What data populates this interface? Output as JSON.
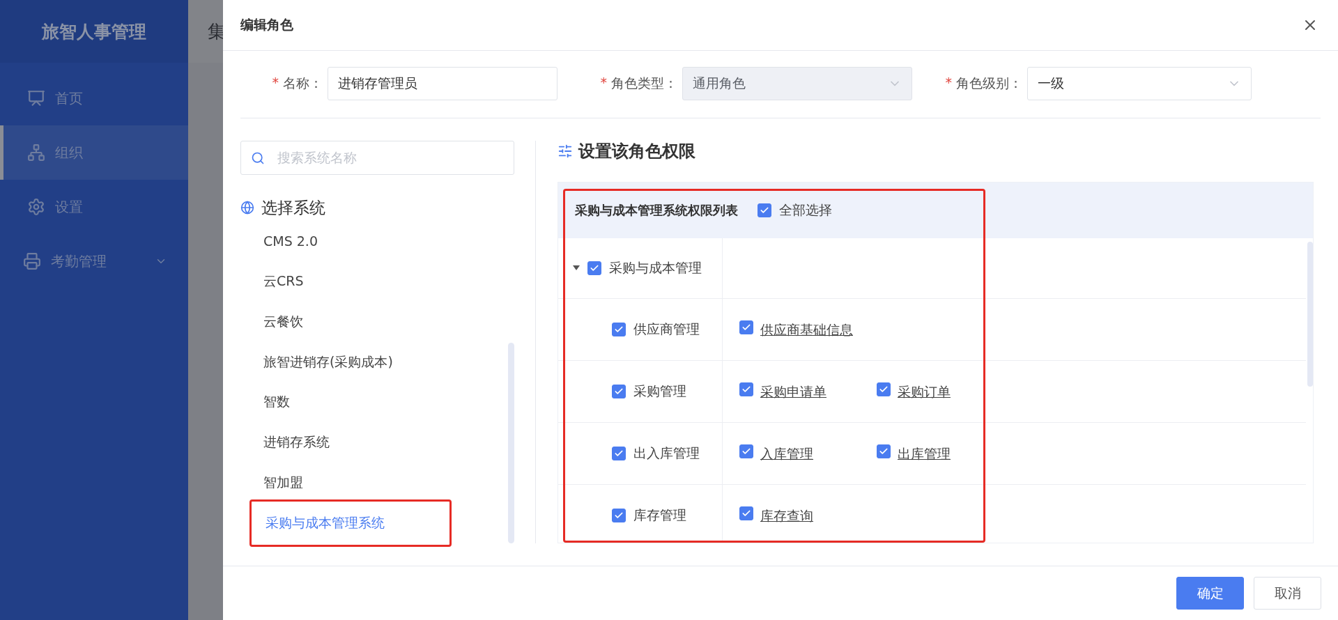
{
  "sidebar": {
    "logo": "旅智人事管理",
    "items": [
      {
        "label": "首页",
        "selected": false,
        "expandable": false
      },
      {
        "label": "组织",
        "selected": true,
        "expandable": false
      },
      {
        "label": "设置",
        "selected": false,
        "expandable": false
      },
      {
        "label": "考勤管理",
        "selected": false,
        "expandable": true
      }
    ]
  },
  "background_header": {
    "title": "集"
  },
  "dialog": {
    "title": "编辑角色",
    "fields": [
      {
        "mark": "*",
        "label": "名称：",
        "kind": "input",
        "value": "进销存管理员",
        "disabled": false
      },
      {
        "mark": "*",
        "label": "角色类型：",
        "kind": "select",
        "value": "通用角色",
        "disabled": true
      },
      {
        "mark": "*",
        "label": "角色级别：",
        "kind": "select",
        "value": "一级",
        "disabled": false
      }
    ],
    "system_panel": {
      "search": {
        "placeholder": "搜索系统名称"
      },
      "heading": "选择系统",
      "systems": [
        {
          "label": "CMS 2.0",
          "selected": false,
          "highlighted": false
        },
        {
          "label": "云CRS",
          "selected": false,
          "highlighted": false
        },
        {
          "label": "云餐饮",
          "selected": false,
          "highlighted": false
        },
        {
          "label": "旅智进销存(采购成本)",
          "selected": false,
          "highlighted": false
        },
        {
          "label": "智数",
          "selected": false,
          "highlighted": false
        },
        {
          "label": "进销存系统",
          "selected": false,
          "highlighted": false
        },
        {
          "label": "智加盟",
          "selected": false,
          "highlighted": false
        },
        {
          "label": "采购与成本管理系统",
          "selected": true,
          "highlighted": true
        }
      ]
    },
    "permissions": {
      "heading": "设置该角色权限",
      "table": {
        "title": "采购与成本管理系统权限列表",
        "highlighted": true,
        "select_all": {
          "label": "全部选择",
          "checked": true
        },
        "modules": [
          {
            "label": "采购与成本管理",
            "checked": true,
            "expanded": true,
            "groups": [
              {
                "label": "供应商管理",
                "checked": true,
                "items": [
                  {
                    "label": "供应商基础信息",
                    "checked": true
                  }
                ]
              },
              {
                "label": "采购管理",
                "checked": true,
                "items": [
                  {
                    "label": "采购申请单",
                    "checked": true
                  },
                  {
                    "label": "采购订单",
                    "checked": true
                  }
                ]
              },
              {
                "label": "出入库管理",
                "checked": true,
                "items": [
                  {
                    "label": "入库管理",
                    "checked": true
                  },
                  {
                    "label": "出库管理",
                    "checked": true
                  }
                ]
              },
              {
                "label": "库存管理",
                "checked": true,
                "items": [
                  {
                    "label": "库存查询",
                    "checked": true
                  }
                ]
              }
            ]
          }
        ]
      }
    },
    "buttons": [
      {
        "label": "确定",
        "kind": "primary"
      },
      {
        "label": "取消",
        "kind": "default"
      }
    ]
  }
}
